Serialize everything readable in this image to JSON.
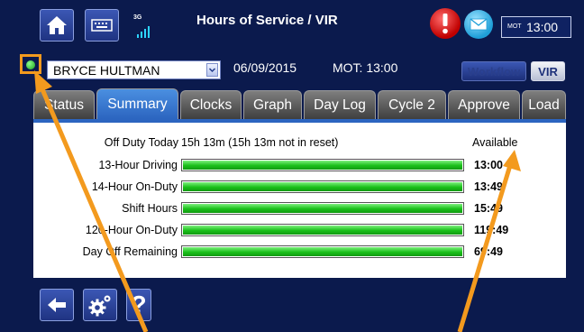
{
  "header": {
    "title": "Hours of Service / VIR",
    "network": "3G",
    "mot_label": "MOT",
    "clock": "13:00"
  },
  "driver_bar": {
    "driver": "BRYCE HULTMAN",
    "date": "06/09/2015",
    "mot_text": "MOT: 13:00",
    "workflow_label": "Workflow",
    "vir_label": "VIR"
  },
  "tabs": [
    {
      "label": "Status"
    },
    {
      "label": "Summary",
      "active": true
    },
    {
      "label": "Clocks"
    },
    {
      "label": "Graph"
    },
    {
      "label": "Day Log"
    },
    {
      "label": "Cycle 2"
    },
    {
      "label": "Approve"
    },
    {
      "label": "Load"
    }
  ],
  "summary": {
    "off_duty_label": "Off Duty Today",
    "off_duty_value": "15h 13m (15h 13m not in reset)",
    "status": "Available",
    "rows": [
      {
        "label": "13-Hour Driving",
        "value": "13:00",
        "fill": 1.0
      },
      {
        "label": "14-Hour On-Duty",
        "value": "13:49",
        "fill": 1.0
      },
      {
        "label": "Shift Hours",
        "value": "15:49",
        "fill": 1.0
      },
      {
        "label": "120-Hour On-Duty",
        "value": "119:49",
        "fill": 1.0
      },
      {
        "label": "Day Off Remaining",
        "value": "69:49",
        "fill": 1.0
      }
    ]
  },
  "colors": {
    "background": "#0b1a4d",
    "accent": "#2c65c0",
    "bar_fill": "#19c019",
    "alert": "#e00000",
    "annotation": "#f39a1e"
  },
  "icons": [
    "home-icon",
    "keyboard-icon",
    "signal-icon",
    "alert-icon",
    "mail-icon",
    "status-led-icon",
    "back-arrow-icon",
    "settings-icon",
    "help-icon"
  ]
}
